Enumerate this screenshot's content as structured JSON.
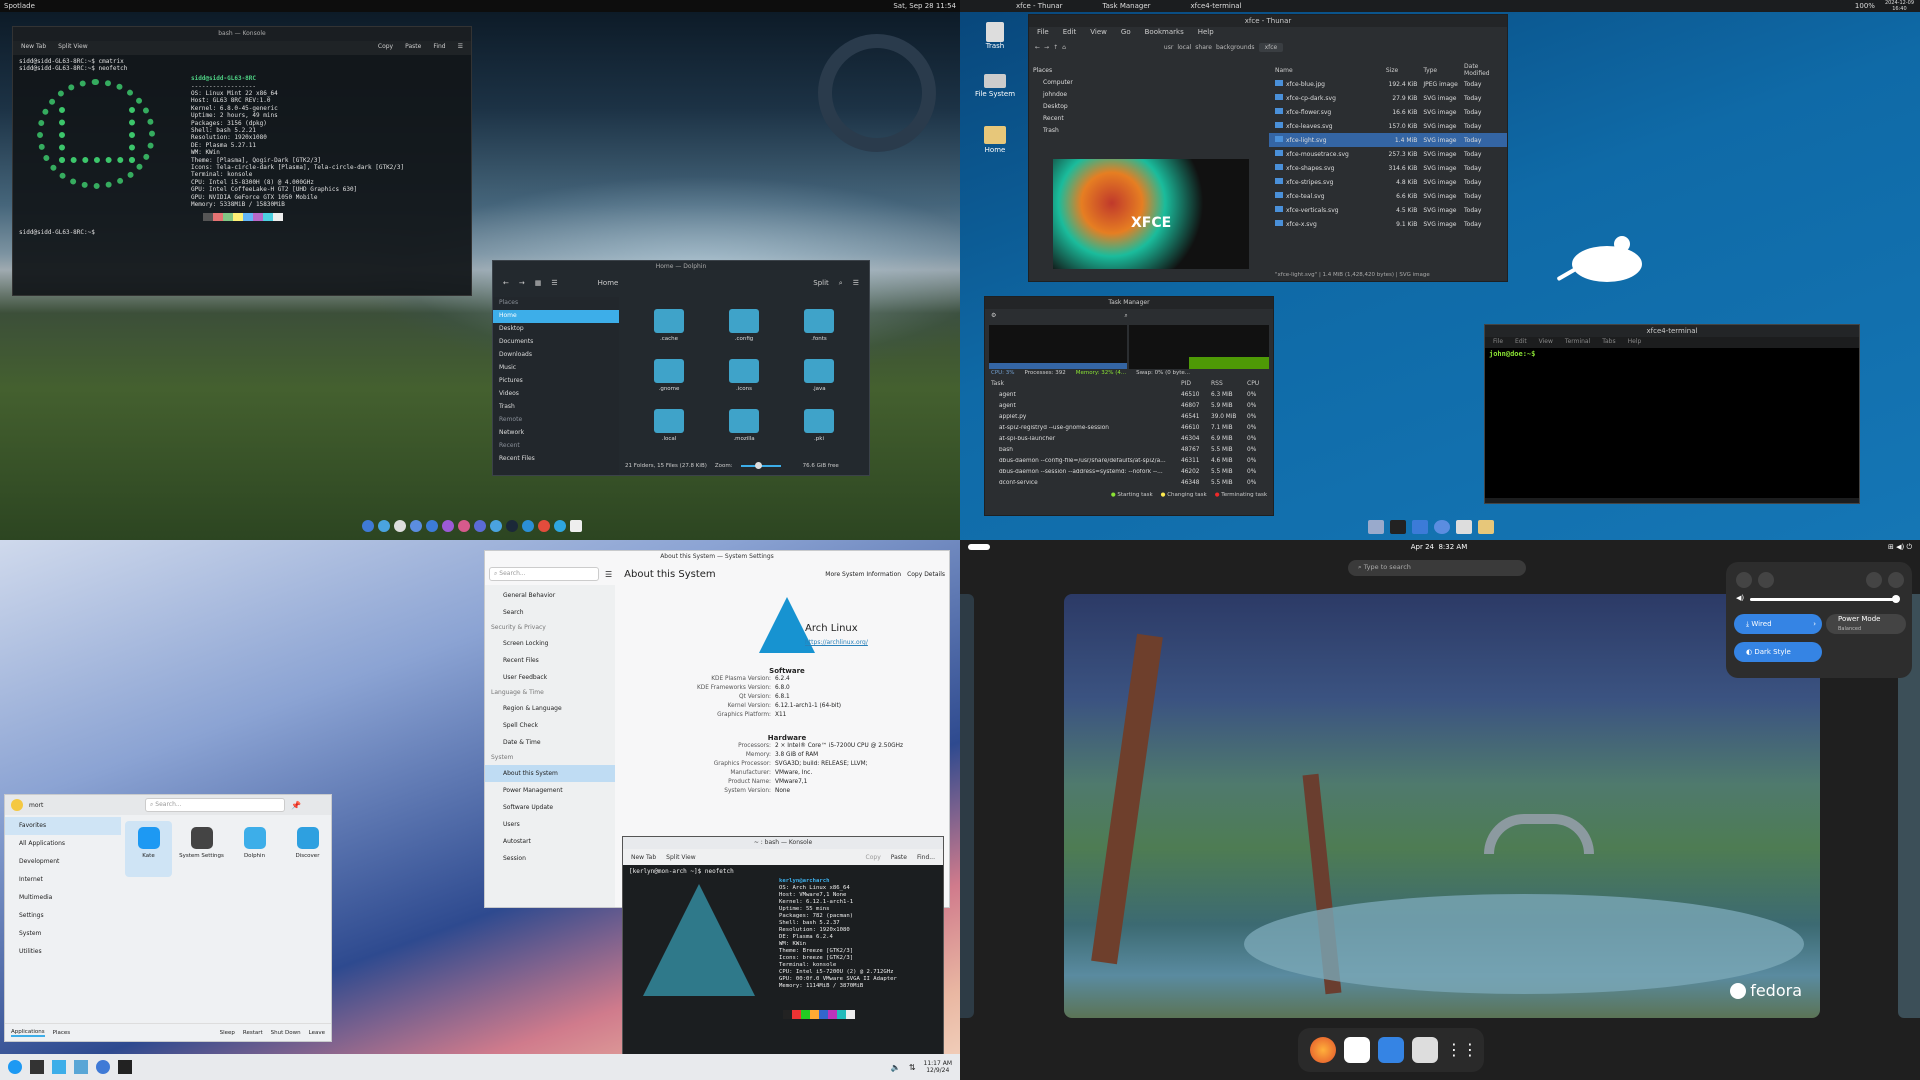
{
  "q1": {
    "topbar": {
      "left": "Spotlade",
      "right": "Sat, Sep 28 11:54"
    },
    "terminal": {
      "title": "bash — Konsole",
      "tab_new": "New Tab",
      "tab_split": "Split View",
      "tools": [
        "Copy",
        "Paste",
        "Find"
      ],
      "prompt1": "sidd@sidd-GL63-8RC:~$ cmatrix",
      "prompt2": "sidd@sidd-GL63-8RC:~$ neofetch",
      "userhost": "sidd@sidd-GL63-8RC",
      "separator": "------------------",
      "info": [
        "OS: Linux Mint 22 x86_64",
        "Host: GL63 8RC REV:1.0",
        "Kernel: 6.8.0-45-generic",
        "Uptime: 2 hours, 49 mins",
        "Packages: 3156 (dpkg)",
        "Shell: bash 5.2.21",
        "Resolution: 1920x1080",
        "DE: Plasma 5.27.11",
        "WM: KWin",
        "Theme: [Plasma], Qogir-Dark [GTK2/3]",
        "Icons: Tela-circle-dark [Plasma], Tela-circle-dark [GTK2/3]",
        "Terminal: konsole",
        "CPU: Intel i5-8300H (8) @ 4.000GHz",
        "GPU: Intel CoffeeLake-H GT2 [UHD Graphics 630]",
        "GPU: NVIDIA GeForce GTX 1050 Mobile",
        "Memory: 5338MiB / 15830MiB"
      ],
      "prompt3": "sidd@sidd-GL63-8RC:~$"
    },
    "dolphin": {
      "title": "Home — Dolphin",
      "location": "Home",
      "split": "Split",
      "places_header": "Places",
      "places": [
        "Home",
        "Desktop",
        "Documents",
        "Downloads",
        "Music",
        "Pictures",
        "Videos",
        "Trash"
      ],
      "remote_header": "Remote",
      "remote": [
        "Network"
      ],
      "recent_header": "Recent",
      "recent": [
        "Recent Files"
      ],
      "folders": [
        ".cache",
        ".config",
        ".fonts",
        ".gnome",
        ".icons",
        ".java",
        ".local",
        ".mozilla",
        ".pki"
      ],
      "status": "21 Folders, 15 Files (27.8 KiB)",
      "zoom_label": "Zoom:",
      "free": "76.6 GiB free"
    }
  },
  "q2": {
    "topbar": {
      "tasks": [
        "xfce - Thunar",
        "Task Manager",
        "xfce4-terminal"
      ],
      "date": "2024-12-09",
      "time": "16:40",
      "battery": "100%"
    },
    "desktop_icons": [
      "Trash",
      "File System",
      "Home"
    ],
    "thunar": {
      "title": "xfce - Thunar",
      "menu": [
        "File",
        "Edit",
        "View",
        "Go",
        "Bookmarks",
        "Help"
      ],
      "path": [
        "usr",
        "local",
        "share",
        "backgrounds",
        "xfce"
      ],
      "places_header": "Places",
      "places": [
        "Computer",
        "johndoe",
        "Desktop",
        "Recent",
        "Trash"
      ],
      "columns": [
        "Name",
        "Size",
        "Type",
        "Date Modified"
      ],
      "files": [
        {
          "name": "xfce-blue.jpg",
          "size": "192.4 KiB",
          "type": "JPEG image",
          "date": "Today"
        },
        {
          "name": "xfce-cp-dark.svg",
          "size": "27.9 KiB",
          "type": "SVG image",
          "date": "Today"
        },
        {
          "name": "xfce-flower.svg",
          "size": "16.6 KiB",
          "type": "SVG image",
          "date": "Today"
        },
        {
          "name": "xfce-leaves.svg",
          "size": "157.0 KiB",
          "type": "SVG image",
          "date": "Today"
        },
        {
          "name": "xfce-light.svg",
          "size": "1.4 MiB",
          "type": "SVG image",
          "date": "Today"
        },
        {
          "name": "xfce-mousetrace.svg",
          "size": "257.3 KiB",
          "type": "SVG image",
          "date": "Today"
        },
        {
          "name": "xfce-shapes.svg",
          "size": "314.6 KiB",
          "type": "SVG image",
          "date": "Today"
        },
        {
          "name": "xfce-stripes.svg",
          "size": "4.8 KiB",
          "type": "SVG image",
          "date": "Today"
        },
        {
          "name": "xfce-teal.svg",
          "size": "6.6 KiB",
          "type": "SVG image",
          "date": "Today"
        },
        {
          "name": "xfce-verticals.svg",
          "size": "4.5 KiB",
          "type": "SVG image",
          "date": "Today"
        },
        {
          "name": "xfce-x.svg",
          "size": "9.1 KiB",
          "type": "SVG image",
          "date": "Today"
        }
      ],
      "preview_text": "XFCE",
      "status": "\"xfce-light.svg\" | 1.4 MiB (1,428,420 bytes) | SVG image"
    },
    "taskmgr": {
      "title": "Task Manager",
      "cpu": "CPU: 3%",
      "processes": "Processes: 392",
      "memory": "Memory: 32% (4...",
      "swap": "Swap: 0% (0 byte...",
      "columns": [
        "Task",
        "PID",
        "RSS",
        "CPU"
      ],
      "rows": [
        {
          "task": "agent",
          "pid": "46510",
          "rss": "6.3 MiB",
          "cpu": "0%"
        },
        {
          "task": "agent",
          "pid": "46807",
          "rss": "5.9 MiB",
          "cpu": "0%"
        },
        {
          "task": "applet.py",
          "pid": "46541",
          "rss": "39.0 MiB",
          "cpu": "0%"
        },
        {
          "task": "at-spi2-registryd --use-gnome-session",
          "pid": "46610",
          "rss": "7.1 MiB",
          "cpu": "0%"
        },
        {
          "task": "at-spi-bus-launcher",
          "pid": "46304",
          "rss": "6.9 MiB",
          "cpu": "0%"
        },
        {
          "task": "bash",
          "pid": "48767",
          "rss": "5.5 MiB",
          "cpu": "0%"
        },
        {
          "task": "dbus-daemon --config-file=/usr/share/defaults/at-spi2/a...",
          "pid": "46311",
          "rss": "4.6 MiB",
          "cpu": "0%"
        },
        {
          "task": "dbus-daemon --session --address=systemd: --nofork --...",
          "pid": "46202",
          "rss": "5.5 MiB",
          "cpu": "0%"
        },
        {
          "task": "dconf-service",
          "pid": "46348",
          "rss": "5.5 MiB",
          "cpu": "0%"
        }
      ],
      "legend": [
        "Starting task",
        "Changing task",
        "Terminating task"
      ]
    },
    "terminal": {
      "title": "xfce4-terminal",
      "menu": [
        "File",
        "Edit",
        "View",
        "Terminal",
        "Tabs",
        "Help"
      ],
      "prompt": "john@doe:~$"
    }
  },
  "q3": {
    "settings": {
      "title": "About this System — System Settings",
      "search_placeholder": "Search...",
      "page_title": "About this System",
      "more_info": "More System Information",
      "copy_details": "Copy Details",
      "sidebar": [
        {
          "t": "item",
          "label": "General Behavior"
        },
        {
          "t": "item",
          "label": "Search"
        },
        {
          "t": "hd",
          "label": "Security & Privacy"
        },
        {
          "t": "item",
          "label": "Screen Locking"
        },
        {
          "t": "item",
          "label": "Recent Files"
        },
        {
          "t": "item",
          "label": "User Feedback"
        },
        {
          "t": "hd",
          "label": "Language & Time"
        },
        {
          "t": "item",
          "label": "Region & Language"
        },
        {
          "t": "item",
          "label": "Spell Check"
        },
        {
          "t": "item",
          "label": "Date & Time"
        },
        {
          "t": "hd",
          "label": "System"
        },
        {
          "t": "sel",
          "label": "About this System"
        },
        {
          "t": "item",
          "label": "Power Management"
        },
        {
          "t": "item",
          "label": "Software Update"
        },
        {
          "t": "item",
          "label": "Users"
        },
        {
          "t": "item",
          "label": "Autostart"
        },
        {
          "t": "item",
          "label": "Session"
        }
      ],
      "distro": "Arch Linux",
      "url": "https://archlinux.org/",
      "software_header": "Software",
      "software": [
        {
          "k": "KDE Plasma Version:",
          "v": "6.2.4"
        },
        {
          "k": "KDE Frameworks Version:",
          "v": "6.8.0"
        },
        {
          "k": "Qt Version:",
          "v": "6.8.1"
        },
        {
          "k": "Kernel Version:",
          "v": "6.12.1-arch1-1 (64-bit)"
        },
        {
          "k": "Graphics Platform:",
          "v": "X11"
        }
      ],
      "hardware_header": "Hardware",
      "hardware": [
        {
          "k": "Processors:",
          "v": "2 × Intel® Core™ i5-7200U CPU @ 2.50GHz"
        },
        {
          "k": "Memory:",
          "v": "3.8 GiB of RAM"
        },
        {
          "k": "Graphics Processor:",
          "v": "SVGA3D; build: RELEASE; LLVM;"
        },
        {
          "k": "Manufacturer:",
          "v": "VMware, Inc."
        },
        {
          "k": "Product Name:",
          "v": "VMware7,1"
        },
        {
          "k": "System Version:",
          "v": "None"
        }
      ]
    },
    "konsole": {
      "title": "~ : bash — Konsole",
      "new_tab": "New Tab",
      "split": "Split View",
      "tools": [
        "Copy",
        "Paste",
        "Find..."
      ],
      "prompt": "[kerlyn@mon-arch ~]$ neofetch",
      "userhost": "kerlyn@archarch",
      "info": [
        "OS: Arch Linux x86_64",
        "Host: VMware7,1 None",
        "Kernel: 6.12.1-arch1-1",
        "Uptime: 55 mins",
        "Packages: 782 (pacman)",
        "Shell: bash 5.2.37",
        "Resolution: 1920x1080",
        "DE: Plasma 6.2.4",
        "WM: KWin",
        "Theme: Breeze [GTK2/3]",
        "Icons: breeze [GTK2/3]",
        "Terminal: konsole",
        "CPU: Intel i5-7200U (2) @ 2.712GHz",
        "GPU: 00:0f.0 VMware SVGA II Adapter",
        "Memory: 1114MiB / 3870MiB"
      ]
    },
    "launcher": {
      "user": "mort",
      "search_placeholder": "Search...",
      "categories": [
        "Favorites",
        "All Applications",
        "Development",
        "Internet",
        "Multimedia",
        "Settings",
        "System",
        "Utilities"
      ],
      "apps": [
        "Kate",
        "System Settings",
        "Dolphin",
        "Discover"
      ],
      "bottom": [
        "Applications",
        "Places"
      ],
      "power": [
        "Sleep",
        "Restart",
        "Shut Down",
        "Leave"
      ]
    },
    "taskbar": {
      "time": "11:17 AM",
      "date": "12/9/24"
    }
  },
  "q4": {
    "topbar": {
      "date": "Apr 24",
      "time": "8:32 AM"
    },
    "search_placeholder": "Type to search",
    "quick": {
      "wired": "Wired",
      "power_mode": "Power Mode",
      "power_sub": "Balanced",
      "dark": "Dark Style",
      "volume": 0.97
    },
    "fedora": "fedora"
  }
}
